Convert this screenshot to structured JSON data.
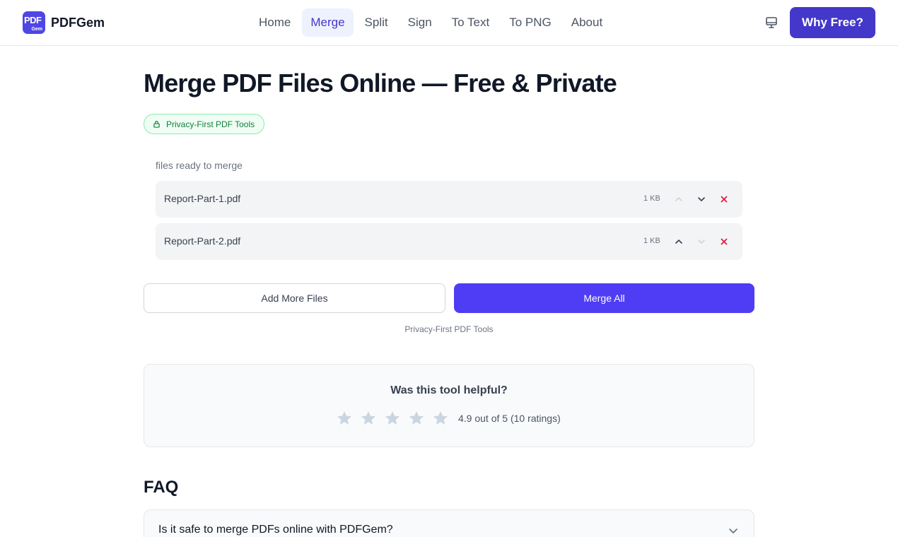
{
  "brand": {
    "logo_line1": "PDF",
    "logo_line2": "Gem",
    "name": "PDFGem"
  },
  "nav": [
    {
      "label": "Home",
      "active": false
    },
    {
      "label": "Merge",
      "active": true
    },
    {
      "label": "Split",
      "active": false
    },
    {
      "label": "Sign",
      "active": false
    },
    {
      "label": "To Text",
      "active": false
    },
    {
      "label": "To PNG",
      "active": false
    },
    {
      "label": "About",
      "active": false
    }
  ],
  "header": {
    "theme_icon": "monitor-icon",
    "cta_label": "Why Free?"
  },
  "page": {
    "title": "Merge PDF Files Online — Free & Private",
    "badge": "Privacy-First PDF Tools"
  },
  "files": {
    "label": "files ready to merge",
    "items": [
      {
        "name": "Report-Part-1.pdf",
        "size": "1 KB"
      },
      {
        "name": "Report-Part-2.pdf",
        "size": "1 KB"
      }
    ]
  },
  "actions": {
    "add_label": "Add More Files",
    "merge_label": "Merge All",
    "footnote": "Privacy-First PDF Tools"
  },
  "rating": {
    "question": "Was this tool helpful?",
    "summary": "4.9 out of 5 (10 ratings)"
  },
  "faq": {
    "title": "FAQ",
    "items": [
      {
        "question": "Is it safe to merge PDFs online with PDFGem?"
      }
    ]
  },
  "colors": {
    "accent": "#4f46e5",
    "primary_button": "#4f3df5",
    "danger": "#e11d48",
    "privacy_green": "#15803d"
  }
}
